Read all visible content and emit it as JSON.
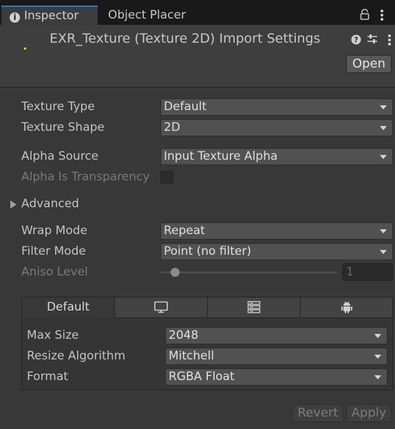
{
  "tabs": {
    "inspector_label": "Inspector",
    "object_placer_label": "Object Placer"
  },
  "header": {
    "title": "EXR_Texture (Texture 2D) Import Settings",
    "open_label": "Open"
  },
  "fields": {
    "texture_type": {
      "label": "Texture Type",
      "value": "Default"
    },
    "texture_shape": {
      "label": "Texture Shape",
      "value": "2D"
    },
    "alpha_source": {
      "label": "Alpha Source",
      "value": "Input Texture Alpha"
    },
    "alpha_is_transparency": {
      "label": "Alpha Is Transparency",
      "checked": false
    },
    "advanced": {
      "label": "Advanced",
      "expanded": false
    },
    "wrap_mode": {
      "label": "Wrap Mode",
      "value": "Repeat"
    },
    "filter_mode": {
      "label": "Filter Mode",
      "value": "Point (no filter)"
    },
    "aniso_level": {
      "label": "Aniso Level",
      "value": "1",
      "slider_fraction": 0.06
    }
  },
  "platform": {
    "tabs": [
      {
        "label": "Default",
        "icon": null
      },
      {
        "label": "",
        "icon": "monitor-icon"
      },
      {
        "label": "",
        "icon": "server-icon"
      },
      {
        "label": "",
        "icon": "android-icon"
      }
    ],
    "max_size": {
      "label": "Max Size",
      "value": "2048"
    },
    "resize_algorithm": {
      "label": "Resize Algorithm",
      "value": "Mitchell"
    },
    "format": {
      "label": "Format",
      "value": "RGBA Float"
    }
  },
  "footer": {
    "revert_label": "Revert",
    "apply_label": "Apply"
  },
  "colors": {
    "background": "#383838",
    "tab_accent": "#3a79bb",
    "dropdown": "#515151",
    "text": "#c4c4c4",
    "disabled_text": "#7a7a7a"
  }
}
